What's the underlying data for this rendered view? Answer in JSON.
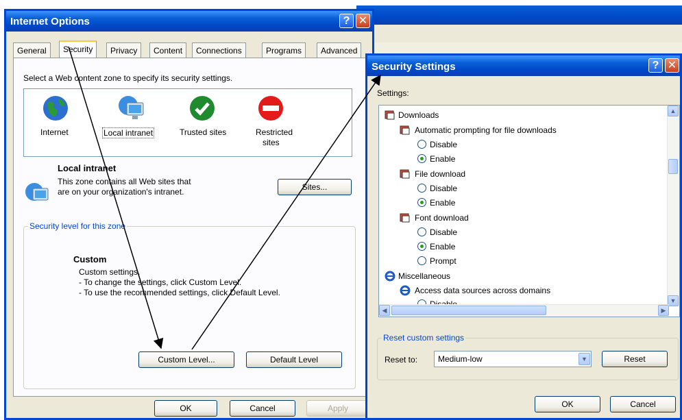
{
  "internet_options": {
    "title": "Internet Options",
    "help_label": "?",
    "close_label": "✕",
    "tabs": [
      "General",
      "Security",
      "Privacy",
      "Content",
      "Connections",
      "Programs",
      "Advanced"
    ],
    "instruction": "Select a Web content zone to specify its security settings.",
    "zones": [
      {
        "label": "Internet",
        "icon": "globe-icon"
      },
      {
        "label": "Local intranet",
        "icon": "intranet-icon"
      },
      {
        "label": "Trusted sites",
        "icon": "check-icon"
      },
      {
        "label": "Restricted",
        "label2": "sites",
        "icon": "restricted-icon"
      }
    ],
    "zone_title": "Local intranet",
    "zone_desc1": "This zone contains all Web sites that",
    "zone_desc2": "are on your organization's intranet.",
    "sites_button": "Sites...",
    "security_group": "Security level for this zone",
    "level_title": "Custom",
    "level_line1": "Custom settings.",
    "level_line2": "- To change the settings, click Custom Level.",
    "level_line3": "- To use the recommended settings, click Default Level.",
    "custom_level_button": "Custom Level...",
    "default_level_button": "Default Level",
    "ok_button": "OK",
    "cancel_button": "Cancel",
    "apply_button": "Apply"
  },
  "security_settings": {
    "title": "Security Settings",
    "help_label": "?",
    "close_label": "✕",
    "settings_label": "Settings:",
    "tree": {
      "downloads": "Downloads",
      "auto_prompt": "Automatic prompting for file downloads",
      "auto_disable": "Disable",
      "auto_enable": "Enable",
      "file_download": "File download",
      "file_disable": "Disable",
      "file_enable": "Enable",
      "font_download": "Font download",
      "font_disable": "Disable",
      "font_enable": "Enable",
      "font_prompt": "Prompt",
      "misc": "Miscellaneous",
      "access_data": "Access data sources across domains",
      "access_disable": "Disable"
    },
    "reset_group": "Reset custom settings",
    "reset_to_label": "Reset to:",
    "reset_value": "Medium-low",
    "reset_button": "Reset",
    "ok_button": "OK",
    "cancel_button": "Cancel"
  },
  "colors": {
    "xp_blue": "#0046d5",
    "window_face": "#ece9d8",
    "radio_selected": "#21a121"
  }
}
